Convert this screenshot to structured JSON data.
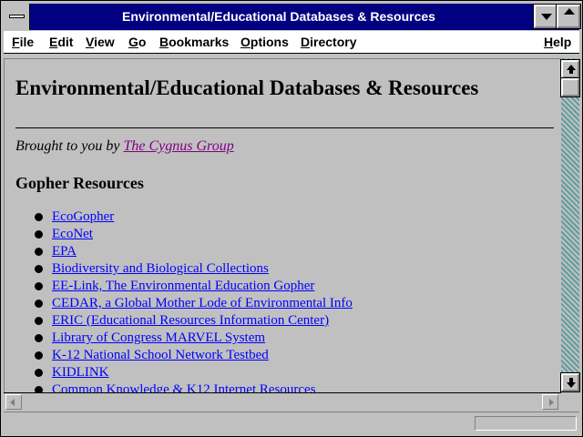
{
  "window": {
    "title": "Environmental/Educational Databases & Resources"
  },
  "menubar": {
    "items": [
      {
        "label": "File",
        "key": "F",
        "rest": "ile"
      },
      {
        "label": "Edit",
        "key": "E",
        "rest": "dit"
      },
      {
        "label": "View",
        "key": "V",
        "rest": "iew"
      },
      {
        "label": "Go",
        "key": "G",
        "rest": "o"
      },
      {
        "label": "Bookmarks",
        "key": "B",
        "rest": "ookmarks"
      },
      {
        "label": "Options",
        "key": "O",
        "rest": "ptions"
      },
      {
        "label": "Directory",
        "key": "D",
        "rest": "irectory"
      },
      {
        "label": "Help",
        "key": "H",
        "rest": "elp"
      }
    ]
  },
  "page": {
    "heading": "Environmental/Educational Databases & Resources",
    "byline_prefix": "Brought to you by ",
    "byline_link": "The Cygnus Group",
    "section_heading": "Gopher Resources",
    "links": [
      "EcoGopher",
      "EcoNet",
      "EPA",
      "Biodiversity and Biological Collections",
      "EE-Link, The Environmental Education Gopher",
      "CEDAR, a Global Mother Lode of Environmental Info",
      "ERIC (Educational Resources Information Center)",
      "Library of Congress MARVEL System",
      "K-12 National School Network Testbed",
      "KIDLINK",
      "Common Knowledge & K12 Internet Resources"
    ]
  },
  "status": {
    "text": ""
  },
  "colors": {
    "titlebar": "#000080",
    "link": "#0000ff",
    "visited_link": "#800080",
    "background": "#c0c0c0"
  }
}
